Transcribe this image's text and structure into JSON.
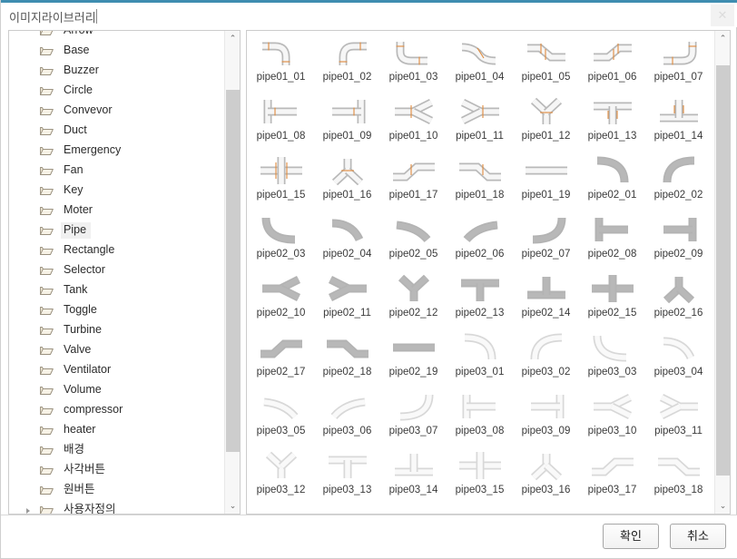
{
  "window": {
    "title": "이미지라이브러리",
    "accent_color": "#3f8db0",
    "close_icon": "close-icon",
    "close_label": "✕"
  },
  "tree": {
    "items": [
      {
        "label": "Arrow",
        "selected": false,
        "clipped": true
      },
      {
        "label": "Base",
        "selected": false
      },
      {
        "label": "Buzzer",
        "selected": false
      },
      {
        "label": "Circle",
        "selected": false
      },
      {
        "label": "Convevor",
        "selected": false
      },
      {
        "label": "Duct",
        "selected": false
      },
      {
        "label": "Emergency",
        "selected": false
      },
      {
        "label": "Fan",
        "selected": false
      },
      {
        "label": "Key",
        "selected": false
      },
      {
        "label": "Moter",
        "selected": false
      },
      {
        "label": "Pipe",
        "selected": true
      },
      {
        "label": "Rectangle",
        "selected": false
      },
      {
        "label": "Selector",
        "selected": false
      },
      {
        "label": "Tank",
        "selected": false
      },
      {
        "label": "Toggle",
        "selected": false
      },
      {
        "label": "Turbine",
        "selected": false
      },
      {
        "label": "Valve",
        "selected": false
      },
      {
        "label": "Ventilator",
        "selected": false
      },
      {
        "label": "Volume",
        "selected": false
      },
      {
        "label": "compressor",
        "selected": false
      },
      {
        "label": "heater",
        "selected": false
      },
      {
        "label": "배경",
        "selected": false
      },
      {
        "label": "사각버튼",
        "selected": false
      },
      {
        "label": "원버튼",
        "selected": false
      },
      {
        "label": "사용자정의",
        "selected": false,
        "expander": true
      }
    ],
    "scrollbar": {
      "up_arrow": "⌃",
      "down_arrow": "⌄",
      "thumb_top_pct": 9,
      "thumb_height_pct": 75
    }
  },
  "icons": {
    "scrollbar": {
      "up_arrow": "⌃",
      "down_arrow": "⌄",
      "thumb_top_pct": 4,
      "thumb_height_pct": 85
    },
    "items": [
      {
        "label": "pipe01_01",
        "shape": "elbow-br",
        "style": "detailed"
      },
      {
        "label": "pipe01_02",
        "shape": "elbow-bl",
        "style": "detailed"
      },
      {
        "label": "pipe01_03",
        "shape": "elbow-tr",
        "style": "detailed"
      },
      {
        "label": "pipe01_04",
        "shape": "bend-down",
        "style": "detailed"
      },
      {
        "label": "pipe01_05",
        "shape": "offset-right",
        "style": "detailed"
      },
      {
        "label": "pipe01_06",
        "shape": "offset-left",
        "style": "detailed"
      },
      {
        "label": "pipe01_07",
        "shape": "elbow-tl",
        "style": "detailed"
      },
      {
        "label": "pipe01_08",
        "shape": "tee-right",
        "style": "detailed"
      },
      {
        "label": "pipe01_09",
        "shape": "tee-left",
        "style": "detailed"
      },
      {
        "label": "pipe01_10",
        "shape": "y-right",
        "style": "detailed"
      },
      {
        "label": "pipe01_11",
        "shape": "y-left",
        "style": "detailed"
      },
      {
        "label": "pipe01_12",
        "shape": "y-up",
        "style": "detailed"
      },
      {
        "label": "pipe01_13",
        "shape": "tee-down",
        "style": "detailed"
      },
      {
        "label": "pipe01_14",
        "shape": "tee-up",
        "style": "detailed"
      },
      {
        "label": "pipe01_15",
        "shape": "cross",
        "style": "detailed"
      },
      {
        "label": "pipe01_16",
        "shape": "y-down",
        "style": "detailed"
      },
      {
        "label": "pipe01_17",
        "shape": "ramp-right",
        "style": "detailed"
      },
      {
        "label": "pipe01_18",
        "shape": "ramp-left",
        "style": "detailed"
      },
      {
        "label": "pipe01_19",
        "shape": "straight",
        "style": "detailed"
      },
      {
        "label": "pipe02_01",
        "shape": "curve-tr",
        "style": "solid"
      },
      {
        "label": "pipe02_02",
        "shape": "curve-tl",
        "style": "solid"
      },
      {
        "label": "pipe02_03",
        "shape": "curve-br",
        "style": "solid"
      },
      {
        "label": "pipe02_04",
        "shape": "curve-sm-tr",
        "style": "solid"
      },
      {
        "label": "pipe02_05",
        "shape": "curve-sm-r",
        "style": "solid"
      },
      {
        "label": "pipe02_06",
        "shape": "curve-sm-l",
        "style": "solid"
      },
      {
        "label": "pipe02_07",
        "shape": "curve-bl",
        "style": "solid"
      },
      {
        "label": "pipe02_08",
        "shape": "tee-right",
        "style": "solid"
      },
      {
        "label": "pipe02_09",
        "shape": "tee-left",
        "style": "solid"
      },
      {
        "label": "pipe02_10",
        "shape": "y-right",
        "style": "solid"
      },
      {
        "label": "pipe02_11",
        "shape": "y-left",
        "style": "solid"
      },
      {
        "label": "pipe02_12",
        "shape": "y-up",
        "style": "solid"
      },
      {
        "label": "pipe02_13",
        "shape": "tee-down",
        "style": "solid"
      },
      {
        "label": "pipe02_14",
        "shape": "tee-up",
        "style": "solid"
      },
      {
        "label": "pipe02_15",
        "shape": "cross",
        "style": "solid"
      },
      {
        "label": "pipe02_16",
        "shape": "y-down",
        "style": "solid"
      },
      {
        "label": "pipe02_17",
        "shape": "ramp-right",
        "style": "solid"
      },
      {
        "label": "pipe02_18",
        "shape": "ramp-left",
        "style": "solid"
      },
      {
        "label": "pipe02_19",
        "shape": "straight",
        "style": "solid"
      },
      {
        "label": "pipe03_01",
        "shape": "curve-tr",
        "style": "light"
      },
      {
        "label": "pipe03_02",
        "shape": "curve-tl",
        "style": "light"
      },
      {
        "label": "pipe03_03",
        "shape": "curve-br",
        "style": "light"
      },
      {
        "label": "pipe03_04",
        "shape": "curve-sm-tr",
        "style": "light"
      },
      {
        "label": "pipe03_05",
        "shape": "curve-sm-r",
        "style": "light"
      },
      {
        "label": "pipe03_06",
        "shape": "curve-sm-l",
        "style": "light"
      },
      {
        "label": "pipe03_07",
        "shape": "curve-bl",
        "style": "light"
      },
      {
        "label": "pipe03_08",
        "shape": "tee-right",
        "style": "light"
      },
      {
        "label": "pipe03_09",
        "shape": "tee-left",
        "style": "light"
      },
      {
        "label": "pipe03_10",
        "shape": "y-right",
        "style": "light"
      },
      {
        "label": "pipe03_11",
        "shape": "y-left",
        "style": "light"
      },
      {
        "label": "pipe03_12",
        "shape": "y-up",
        "style": "light"
      },
      {
        "label": "pipe03_13",
        "shape": "tee-down",
        "style": "light"
      },
      {
        "label": "pipe03_14",
        "shape": "tee-up",
        "style": "light"
      },
      {
        "label": "pipe03_15",
        "shape": "cross",
        "style": "light"
      },
      {
        "label": "pipe03_16",
        "shape": "y-down",
        "style": "light"
      },
      {
        "label": "pipe03_17",
        "shape": "ramp-right",
        "style": "light"
      },
      {
        "label": "pipe03_18",
        "shape": "ramp-left",
        "style": "light"
      }
    ]
  },
  "footer": {
    "ok_label": "확인",
    "cancel_label": "취소"
  }
}
